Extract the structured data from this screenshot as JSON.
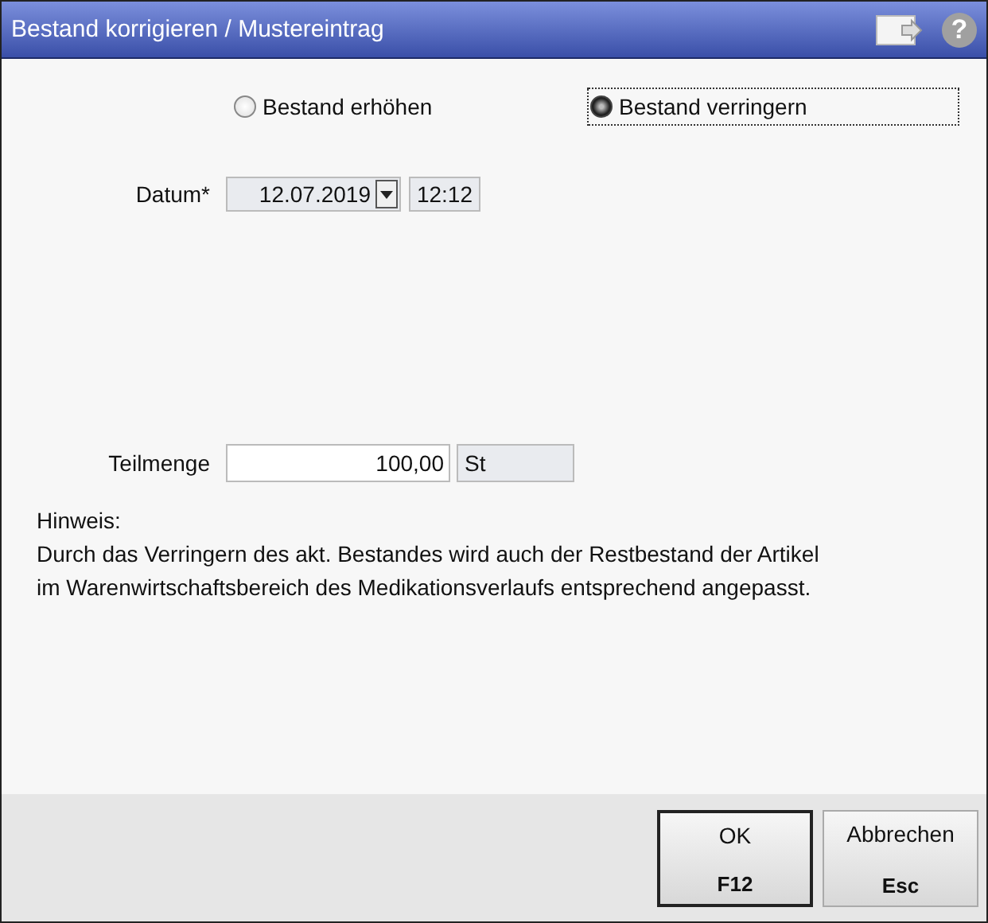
{
  "window": {
    "title": "Bestand korrigieren / Mustereintrag",
    "help": "?"
  },
  "radios": [
    {
      "label": "Bestand erhöhen",
      "selected": false,
      "focused": false
    },
    {
      "label": "Bestand verringern",
      "selected": true,
      "focused": true
    }
  ],
  "datum": {
    "label": "Datum*",
    "date": "12.07.2019",
    "time": "12:12"
  },
  "teilmenge": {
    "label": "Teilmenge",
    "value": "100,00",
    "unit": "St"
  },
  "hint": {
    "title": "Hinweis:",
    "lines": [
      "Durch das Verringern des akt. Bestandes wird auch der Restbestand der Artikel",
      "im Warenwirtschaftsbereich des Medikationsverlaufs entsprechend angepasst."
    ]
  },
  "buttons": [
    {
      "label": "OK",
      "key": "F12",
      "default": true
    },
    {
      "label": "Abbrechen",
      "key": "Esc",
      "default": false
    }
  ]
}
